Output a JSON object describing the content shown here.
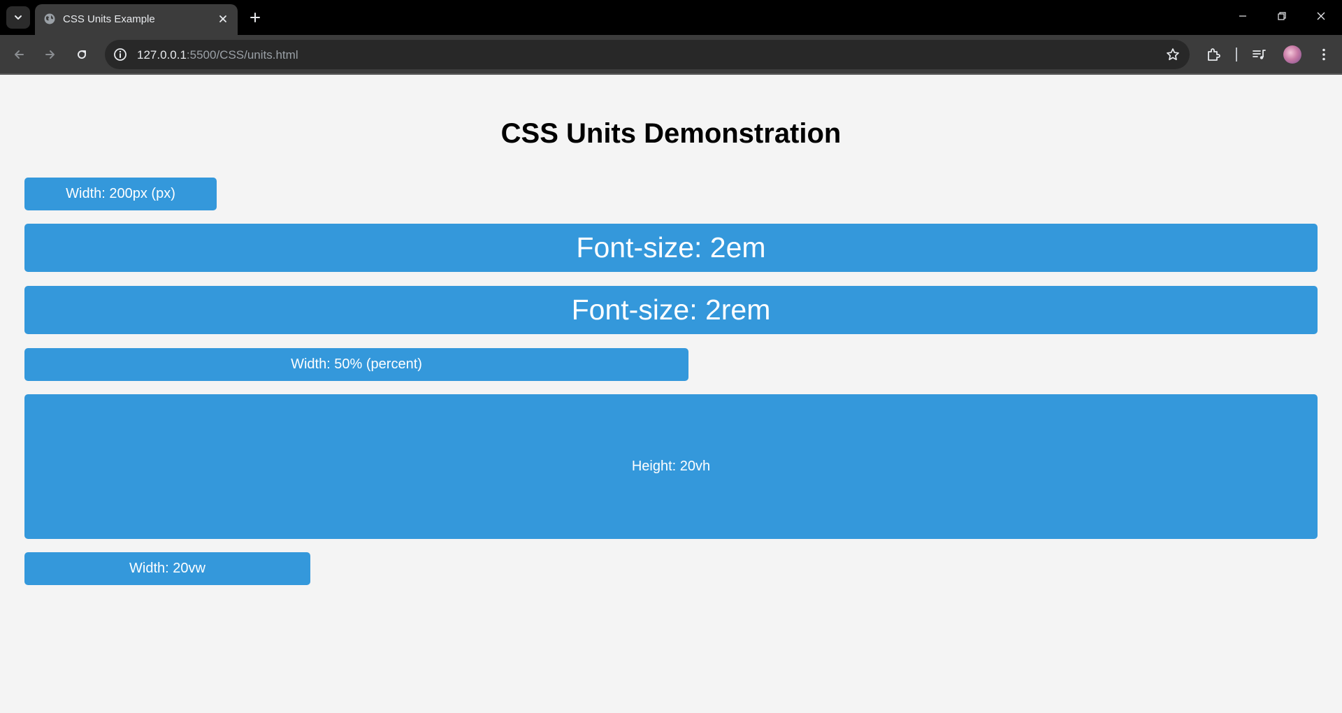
{
  "browser": {
    "tab": {
      "title": "CSS Units Example"
    },
    "address_bar": {
      "host": "127.0.0.1",
      "path": ":5500/CSS/units.html"
    }
  },
  "page": {
    "heading": "CSS Units Demonstration",
    "boxes": [
      {
        "label": "Width: 200px (px)"
      },
      {
        "label": "Font-size: 2em"
      },
      {
        "label": "Font-size: 2rem"
      },
      {
        "label": "Width: 50% (percent)"
      },
      {
        "label": "Height: 20vh"
      },
      {
        "label": "Width: 20vw"
      }
    ],
    "accent_color": "#3498db",
    "background_color": "#f4f4f4"
  }
}
